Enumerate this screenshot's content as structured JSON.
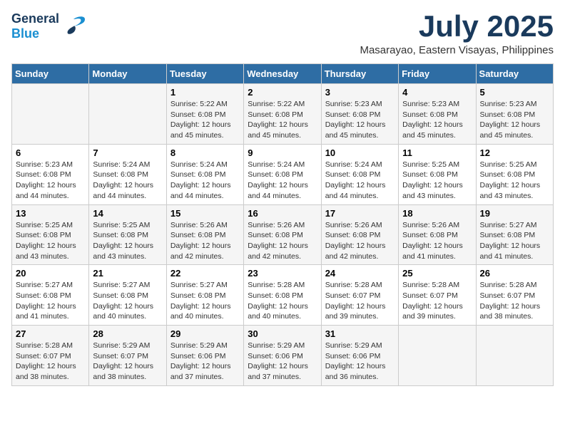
{
  "logo": {
    "general": "General",
    "blue": "Blue"
  },
  "title": "July 2025",
  "subtitle": "Masarayao, Eastern Visayas, Philippines",
  "days_header": [
    "Sunday",
    "Monday",
    "Tuesday",
    "Wednesday",
    "Thursday",
    "Friday",
    "Saturday"
  ],
  "weeks": [
    [
      {
        "day": "",
        "info": ""
      },
      {
        "day": "",
        "info": ""
      },
      {
        "day": "1",
        "info": "Sunrise: 5:22 AM\nSunset: 6:08 PM\nDaylight: 12 hours and 45 minutes."
      },
      {
        "day": "2",
        "info": "Sunrise: 5:22 AM\nSunset: 6:08 PM\nDaylight: 12 hours and 45 minutes."
      },
      {
        "day": "3",
        "info": "Sunrise: 5:23 AM\nSunset: 6:08 PM\nDaylight: 12 hours and 45 minutes."
      },
      {
        "day": "4",
        "info": "Sunrise: 5:23 AM\nSunset: 6:08 PM\nDaylight: 12 hours and 45 minutes."
      },
      {
        "day": "5",
        "info": "Sunrise: 5:23 AM\nSunset: 6:08 PM\nDaylight: 12 hours and 45 minutes."
      }
    ],
    [
      {
        "day": "6",
        "info": "Sunrise: 5:23 AM\nSunset: 6:08 PM\nDaylight: 12 hours and 44 minutes."
      },
      {
        "day": "7",
        "info": "Sunrise: 5:24 AM\nSunset: 6:08 PM\nDaylight: 12 hours and 44 minutes."
      },
      {
        "day": "8",
        "info": "Sunrise: 5:24 AM\nSunset: 6:08 PM\nDaylight: 12 hours and 44 minutes."
      },
      {
        "day": "9",
        "info": "Sunrise: 5:24 AM\nSunset: 6:08 PM\nDaylight: 12 hours and 44 minutes."
      },
      {
        "day": "10",
        "info": "Sunrise: 5:24 AM\nSunset: 6:08 PM\nDaylight: 12 hours and 44 minutes."
      },
      {
        "day": "11",
        "info": "Sunrise: 5:25 AM\nSunset: 6:08 PM\nDaylight: 12 hours and 43 minutes."
      },
      {
        "day": "12",
        "info": "Sunrise: 5:25 AM\nSunset: 6:08 PM\nDaylight: 12 hours and 43 minutes."
      }
    ],
    [
      {
        "day": "13",
        "info": "Sunrise: 5:25 AM\nSunset: 6:08 PM\nDaylight: 12 hours and 43 minutes."
      },
      {
        "day": "14",
        "info": "Sunrise: 5:25 AM\nSunset: 6:08 PM\nDaylight: 12 hours and 43 minutes."
      },
      {
        "day": "15",
        "info": "Sunrise: 5:26 AM\nSunset: 6:08 PM\nDaylight: 12 hours and 42 minutes."
      },
      {
        "day": "16",
        "info": "Sunrise: 5:26 AM\nSunset: 6:08 PM\nDaylight: 12 hours and 42 minutes."
      },
      {
        "day": "17",
        "info": "Sunrise: 5:26 AM\nSunset: 6:08 PM\nDaylight: 12 hours and 42 minutes."
      },
      {
        "day": "18",
        "info": "Sunrise: 5:26 AM\nSunset: 6:08 PM\nDaylight: 12 hours and 41 minutes."
      },
      {
        "day": "19",
        "info": "Sunrise: 5:27 AM\nSunset: 6:08 PM\nDaylight: 12 hours and 41 minutes."
      }
    ],
    [
      {
        "day": "20",
        "info": "Sunrise: 5:27 AM\nSunset: 6:08 PM\nDaylight: 12 hours and 41 minutes."
      },
      {
        "day": "21",
        "info": "Sunrise: 5:27 AM\nSunset: 6:08 PM\nDaylight: 12 hours and 40 minutes."
      },
      {
        "day": "22",
        "info": "Sunrise: 5:27 AM\nSunset: 6:08 PM\nDaylight: 12 hours and 40 minutes."
      },
      {
        "day": "23",
        "info": "Sunrise: 5:28 AM\nSunset: 6:08 PM\nDaylight: 12 hours and 40 minutes."
      },
      {
        "day": "24",
        "info": "Sunrise: 5:28 AM\nSunset: 6:07 PM\nDaylight: 12 hours and 39 minutes."
      },
      {
        "day": "25",
        "info": "Sunrise: 5:28 AM\nSunset: 6:07 PM\nDaylight: 12 hours and 39 minutes."
      },
      {
        "day": "26",
        "info": "Sunrise: 5:28 AM\nSunset: 6:07 PM\nDaylight: 12 hours and 38 minutes."
      }
    ],
    [
      {
        "day": "27",
        "info": "Sunrise: 5:28 AM\nSunset: 6:07 PM\nDaylight: 12 hours and 38 minutes."
      },
      {
        "day": "28",
        "info": "Sunrise: 5:29 AM\nSunset: 6:07 PM\nDaylight: 12 hours and 38 minutes."
      },
      {
        "day": "29",
        "info": "Sunrise: 5:29 AM\nSunset: 6:06 PM\nDaylight: 12 hours and 37 minutes."
      },
      {
        "day": "30",
        "info": "Sunrise: 5:29 AM\nSunset: 6:06 PM\nDaylight: 12 hours and 37 minutes."
      },
      {
        "day": "31",
        "info": "Sunrise: 5:29 AM\nSunset: 6:06 PM\nDaylight: 12 hours and 36 minutes."
      },
      {
        "day": "",
        "info": ""
      },
      {
        "day": "",
        "info": ""
      }
    ]
  ]
}
